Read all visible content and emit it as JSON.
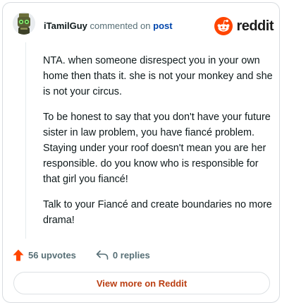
{
  "header": {
    "username": "iTamilGuy",
    "action_text": "commented on",
    "post_link": "post",
    "brand": "reddit",
    "brand_color": "#ff4500"
  },
  "comment": {
    "paragraphs": [
      "NTA. when someone disrespect you in your own home then thats it. she is not your monkey and she is not your circus.",
      "To be honest to say that you don't have your future sister in law problem, you have fiancé problem. Staying under your roof doesn't mean you are her responsible. do you know who is responsible for that girl you fiancé!",
      "Talk to your Fiancé and create boundaries no more drama!"
    ]
  },
  "actions": {
    "upvotes": "56 upvotes",
    "upvote_icon": "upvote-arrow-icon",
    "upvote_color": "#ff4500",
    "replies": "0 replies",
    "reply_icon": "reply-arrow-icon"
  },
  "footer": {
    "view_more": "View more on Reddit",
    "accent": "#ba3e12"
  }
}
